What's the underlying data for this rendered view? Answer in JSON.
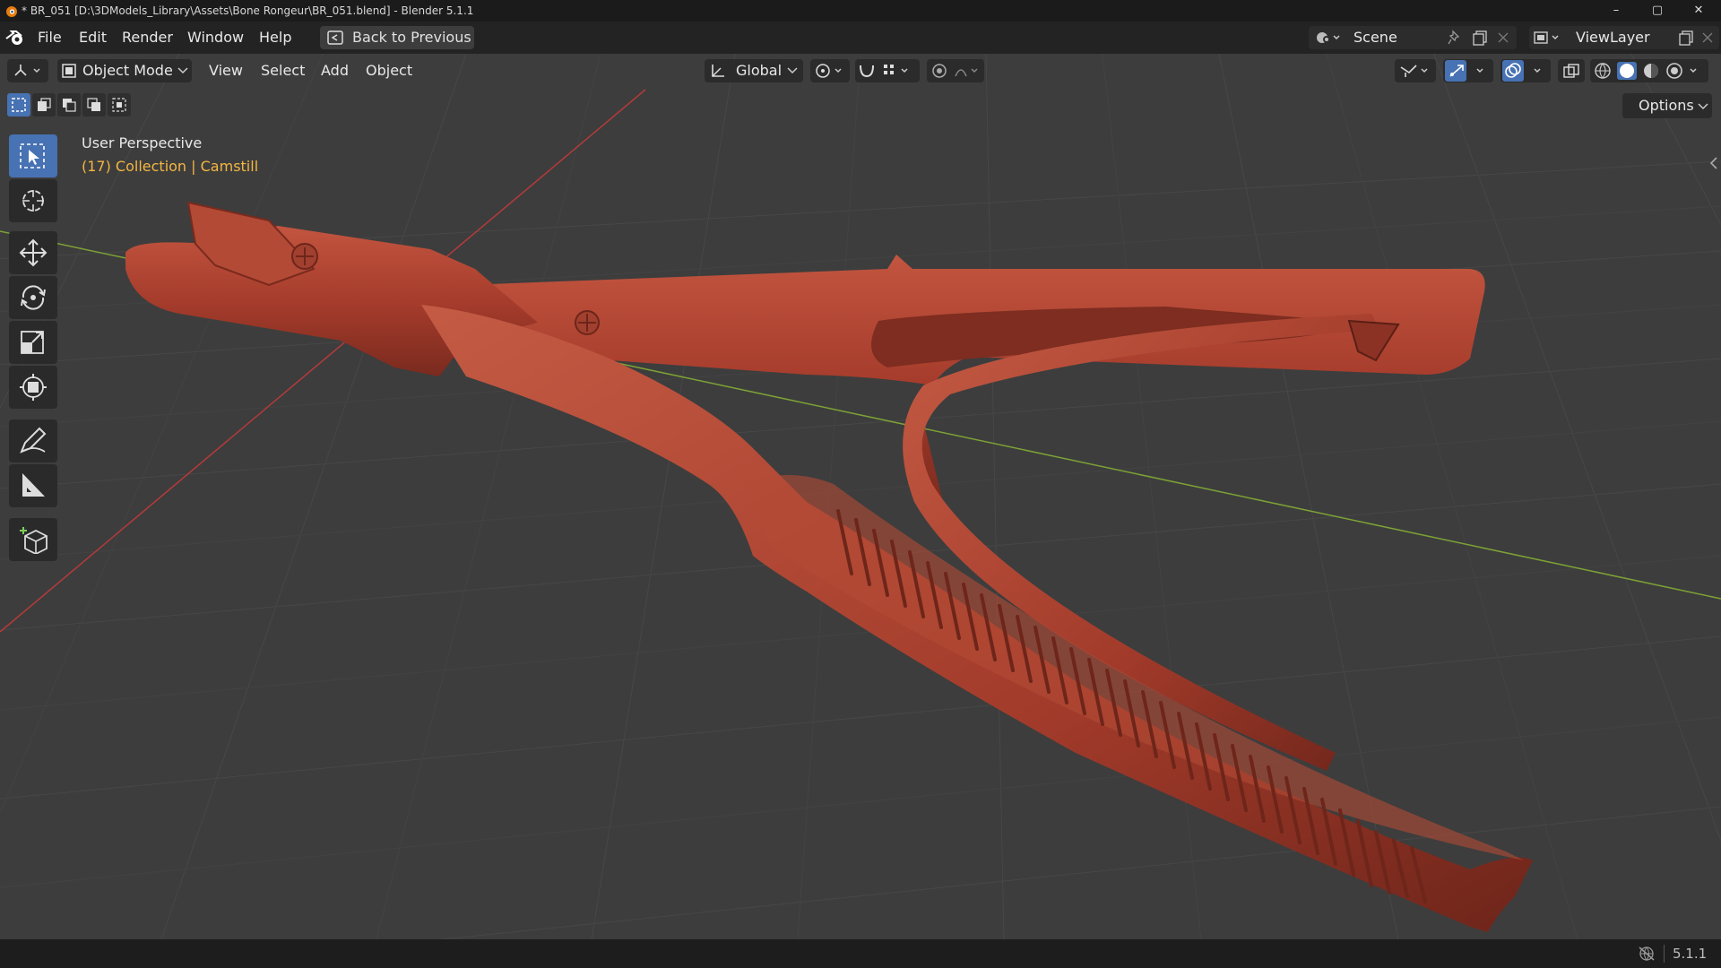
{
  "window": {
    "title": "* BR_051 [D:\\3DModels_Library\\Assets\\Bone Rongeur\\BR_051.blend] - Blender 5.1.1",
    "controls": [
      "–",
      "▢",
      "✕"
    ]
  },
  "menubar": {
    "items": [
      "File",
      "Edit",
      "Render",
      "Window",
      "Help"
    ],
    "back_button": "Back to Previous",
    "scene": "Scene",
    "view_layer": "ViewLayer"
  },
  "viewport_header": {
    "mode": "Object Mode",
    "menus": [
      "View",
      "Select",
      "Add",
      "Object"
    ],
    "transform_orientation": "Global",
    "options_label": "Options"
  },
  "viewport": {
    "perspective": "User Perspective",
    "collection_info": "(17) Collection | Camstill",
    "active_tool": "select-box",
    "shading_mode": "solid",
    "colors": {
      "background": "#3d3d3d",
      "grid": "#4a4a4a",
      "x_axis": "#b53a3a",
      "y_axis": "#7da235",
      "object": "#a63c2c",
      "accent": "#4772b3",
      "text_highlight": "#f5b642"
    }
  },
  "toolbar": {
    "tools": [
      "select-box",
      "cursor",
      "move",
      "rotate",
      "scale",
      "transform",
      "annotate",
      "measure",
      "add-cube"
    ]
  },
  "statusbar": {
    "version": "5.1.1"
  }
}
